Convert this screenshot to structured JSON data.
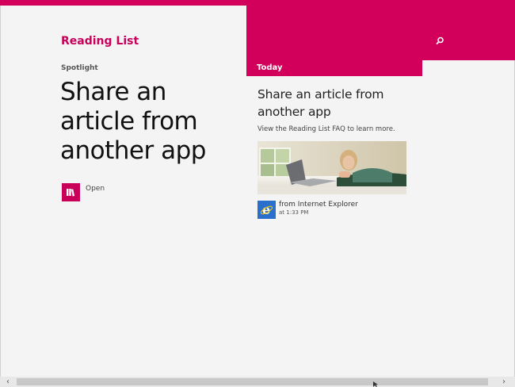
{
  "app": {
    "title": "Reading List"
  },
  "spotlight": {
    "section_label": "Spotlight",
    "title": "Share an article from another app",
    "open_label": "Open",
    "open_icon": "book-icon"
  },
  "today": {
    "section_label": "Today",
    "card": {
      "title": "Share an article from another app",
      "description": "View the Reading List FAQ to learn more.",
      "source": "from Internet Explorer",
      "time": "at 1:33 PM",
      "source_icon": "internet-explorer-icon",
      "thumbnail": "woman-with-laptop-photo"
    }
  },
  "search": {
    "icon": "search-icon"
  },
  "scrollbar": {
    "left_arrow": "‹",
    "right_arrow": "›"
  },
  "colors": {
    "accent": "#d2005a",
    "background": "#f4f4f4",
    "ie_blue": "#2a6fcc"
  }
}
